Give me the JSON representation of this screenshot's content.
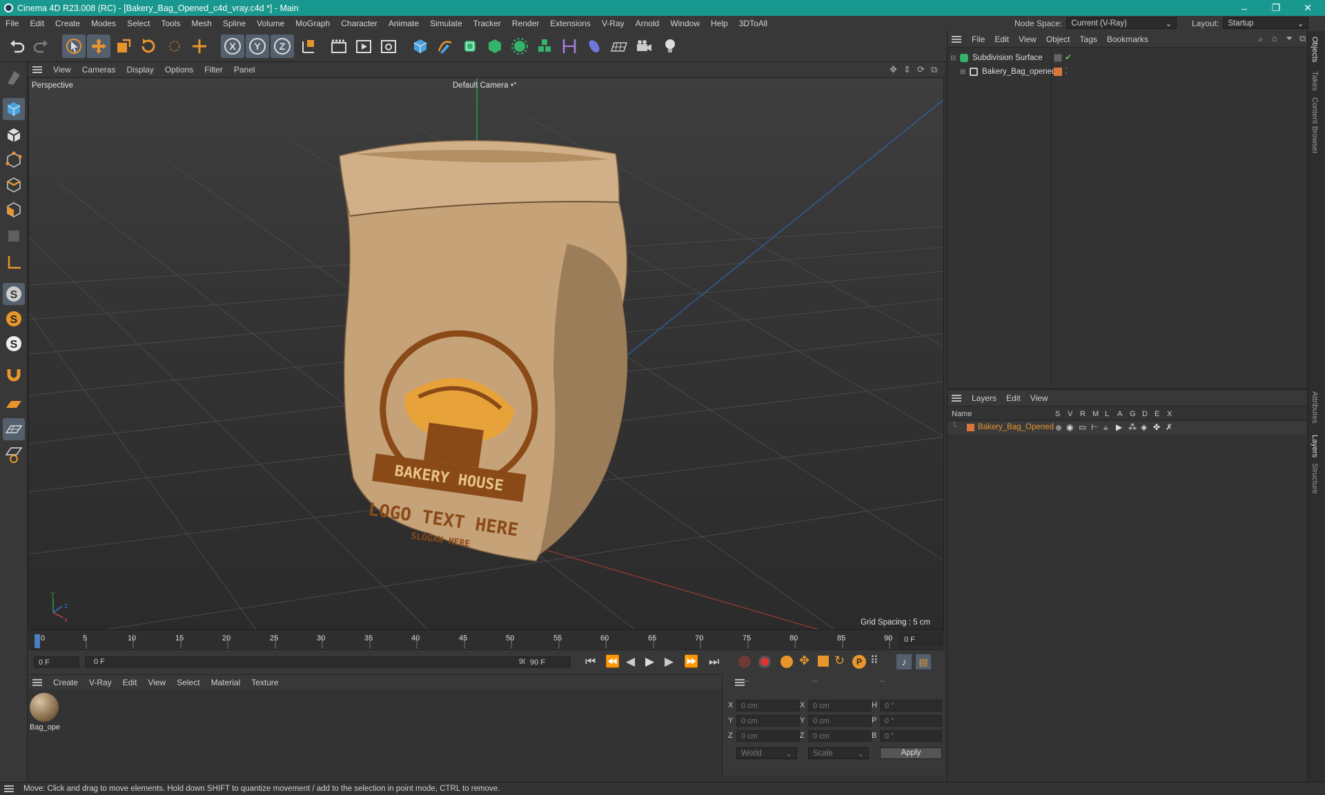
{
  "window": {
    "title": "Cinema 4D R23.008 (RC) - [Bakery_Bag_Opened_c4d_vray.c4d *] - Main",
    "minimize": "–",
    "maximize": "❐",
    "close": "✕"
  },
  "menubar": {
    "items": [
      "File",
      "Edit",
      "Create",
      "Modes",
      "Select",
      "Tools",
      "Mesh",
      "Spline",
      "Volume",
      "MoGraph",
      "Character",
      "Animate",
      "Simulate",
      "Tracker",
      "Render",
      "Extensions",
      "V-Ray",
      "Arnold",
      "Window",
      "Help",
      "3DToAll"
    ],
    "node_space_label": "Node Space:",
    "node_space_value": "Current (V-Ray)",
    "layout_label": "Layout:",
    "layout_value": "Startup"
  },
  "viewport": {
    "menu": [
      "View",
      "Cameras",
      "Display",
      "Options",
      "Filter",
      "Panel"
    ],
    "view_name": "Perspective",
    "camera": "Default Camera",
    "camera_mark": "•°",
    "grid_spacing": "Grid Spacing : 5 cm",
    "bag_logo_text": "BAKERY HOUSE",
    "bag_sub_text": "LOGO TEXT HERE",
    "bag_slogan": "SLOGAN HERE",
    "axis_y": "y",
    "axis_z": "z",
    "axis_x": "x"
  },
  "timeline": {
    "ticks": [
      "0",
      "5",
      "10",
      "15",
      "20",
      "25",
      "30",
      "35",
      "40",
      "45",
      "50",
      "55",
      "60",
      "65",
      "70",
      "75",
      "80",
      "85",
      "90"
    ],
    "current_frame": "0 F"
  },
  "transport": {
    "start": "0 F",
    "range_start": "0 F",
    "range_end": "90 F",
    "end": "90 F"
  },
  "materials": {
    "menu": [
      "Create",
      "V-Ray",
      "Edit",
      "View",
      "Select",
      "Material",
      "Texture"
    ],
    "items": [
      {
        "name": "Bag_ope"
      }
    ]
  },
  "coords": {
    "headers": [
      "--",
      "--",
      "--"
    ],
    "rows": [
      {
        "l1": "X",
        "v1": "0 cm",
        "l2": "X",
        "v2": "0 cm",
        "l3": "H",
        "v3": "0 °"
      },
      {
        "l1": "Y",
        "v1": "0 cm",
        "l2": "Y",
        "v2": "0 cm",
        "l3": "P",
        "v3": "0 °"
      },
      {
        "l1": "Z",
        "v1": "0 cm",
        "l2": "Z",
        "v2": "0 cm",
        "l3": "B",
        "v3": "0 °"
      }
    ],
    "mode1": "World",
    "mode2": "Scale",
    "apply": "Apply"
  },
  "objects": {
    "menu": [
      "File",
      "Edit",
      "View",
      "Object",
      "Tags",
      "Bookmarks"
    ],
    "items": [
      {
        "name": "Subdivision Surface",
        "color": "#5fc15f"
      },
      {
        "name": "Bakery_Bag_opened",
        "color": "#d9773a"
      }
    ]
  },
  "layers": {
    "menu": [
      "Layers",
      "Edit",
      "View"
    ],
    "columns": [
      "Name",
      "S",
      "V",
      "R",
      "M",
      "L",
      "A",
      "G",
      "D",
      "E",
      "X"
    ],
    "items": [
      {
        "name": "Bakery_Bag_Opened",
        "color": "#d9773a"
      }
    ]
  },
  "side_tabs": [
    "Objects",
    "Takes",
    "Content Browser",
    "Attributes",
    "Layers",
    "Structure"
  ],
  "status": "Move: Click and drag to move elements. Hold down SHIFT to quantize movement / add to the selection in point mode, CTRL to remove.",
  "colors": {
    "accent": "#19988f",
    "orange": "#e8962c",
    "selection": "#55606e"
  }
}
